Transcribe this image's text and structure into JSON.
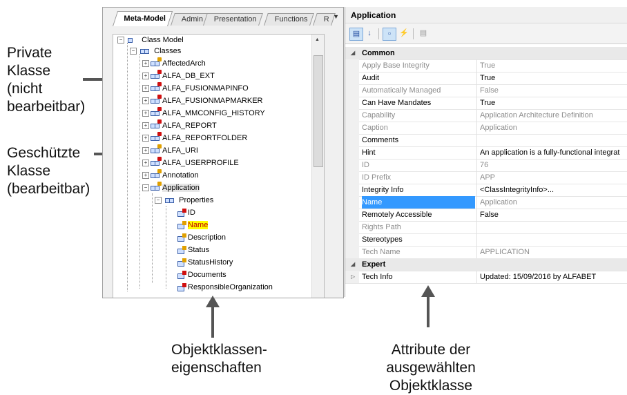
{
  "annotations": {
    "private_class": [
      "Private",
      "Klasse",
      "(nicht",
      "bearbeitbar)"
    ],
    "protected_class": [
      "Geschützte",
      "Klasse",
      "(bearbeitbar)"
    ],
    "object_properties": [
      "Objektklassen-",
      "eigenschaften"
    ],
    "selected_attributes": [
      "Attribute der",
      "ausgewählten",
      "Objektklasse"
    ]
  },
  "tabs": [
    "Meta-Model",
    "Admin",
    "Presentation",
    "Functions",
    "R"
  ],
  "active_tab": "Meta-Model",
  "tree": {
    "root": "Class Model",
    "classes_label": "Classes",
    "classes": [
      {
        "name": "AffectedArch",
        "lock": "yellow"
      },
      {
        "name": "ALFA_DB_EXT",
        "lock": "red"
      },
      {
        "name": "ALFA_FUSIONMAPINFO",
        "lock": "red"
      },
      {
        "name": "ALFA_FUSIONMAPMARKER",
        "lock": "red"
      },
      {
        "name": "ALFA_MMCONFIG_HISTORY",
        "lock": "red"
      },
      {
        "name": "ALFA_REPORT",
        "lock": "red"
      },
      {
        "name": "ALFA_REPORTFOLDER",
        "lock": "red"
      },
      {
        "name": "ALFA_URI",
        "lock": "yellow"
      },
      {
        "name": "ALFA_USERPROFILE",
        "lock": "red"
      },
      {
        "name": "Annotation",
        "lock": "yellow"
      },
      {
        "name": "Application",
        "lock": "yellow"
      }
    ],
    "properties_label": "Properties",
    "properties": [
      {
        "name": "ID",
        "lock": "red"
      },
      {
        "name": "Name",
        "lock": "yellow"
      },
      {
        "name": "Description",
        "lock": "yellow"
      },
      {
        "name": "Status",
        "lock": "yellow"
      },
      {
        "name": "StatusHistory",
        "lock": "yellow"
      },
      {
        "name": "Documents",
        "lock": "red"
      },
      {
        "name": "ResponsibleOrganization",
        "lock": "red"
      }
    ]
  },
  "properties_panel": {
    "title": "Application",
    "categories": [
      {
        "label": "Common",
        "rows": [
          {
            "name": "Apply Base Integrity",
            "value": "True",
            "readonly": true
          },
          {
            "name": "Audit",
            "value": "True",
            "readonly": false
          },
          {
            "name": "Automatically Managed",
            "value": "False",
            "readonly": true
          },
          {
            "name": "Can Have Mandates",
            "value": "True",
            "readonly": false
          },
          {
            "name": "Capability",
            "value": "Application Architecture Definition",
            "readonly": true
          },
          {
            "name": "Caption",
            "value": "Application",
            "readonly": true
          },
          {
            "name": "Comments",
            "value": "",
            "readonly": false
          },
          {
            "name": "Hint",
            "value": "An application is a fully-functional integrat",
            "readonly": false
          },
          {
            "name": "ID",
            "value": "76",
            "readonly": true
          },
          {
            "name": "ID Prefix",
            "value": "APP",
            "readonly": true
          },
          {
            "name": "Integrity Info",
            "value": "<ClassIntegrityInfo>...",
            "readonly": false
          },
          {
            "name": "Name",
            "value": "Application",
            "readonly": true,
            "selected": true
          },
          {
            "name": "Remotely Accessible",
            "value": "False",
            "readonly": false
          },
          {
            "name": "Rights Path",
            "value": "",
            "readonly": true
          },
          {
            "name": "Stereotypes",
            "value": "",
            "readonly": false
          },
          {
            "name": "Tech Name",
            "value": "APPLICATION",
            "readonly": true
          }
        ]
      },
      {
        "label": "Expert",
        "rows": [
          {
            "name": "Tech Info",
            "value": "Updated: 15/09/2016 by ALFABET",
            "readonly": false,
            "expandable": true
          }
        ]
      }
    ]
  }
}
